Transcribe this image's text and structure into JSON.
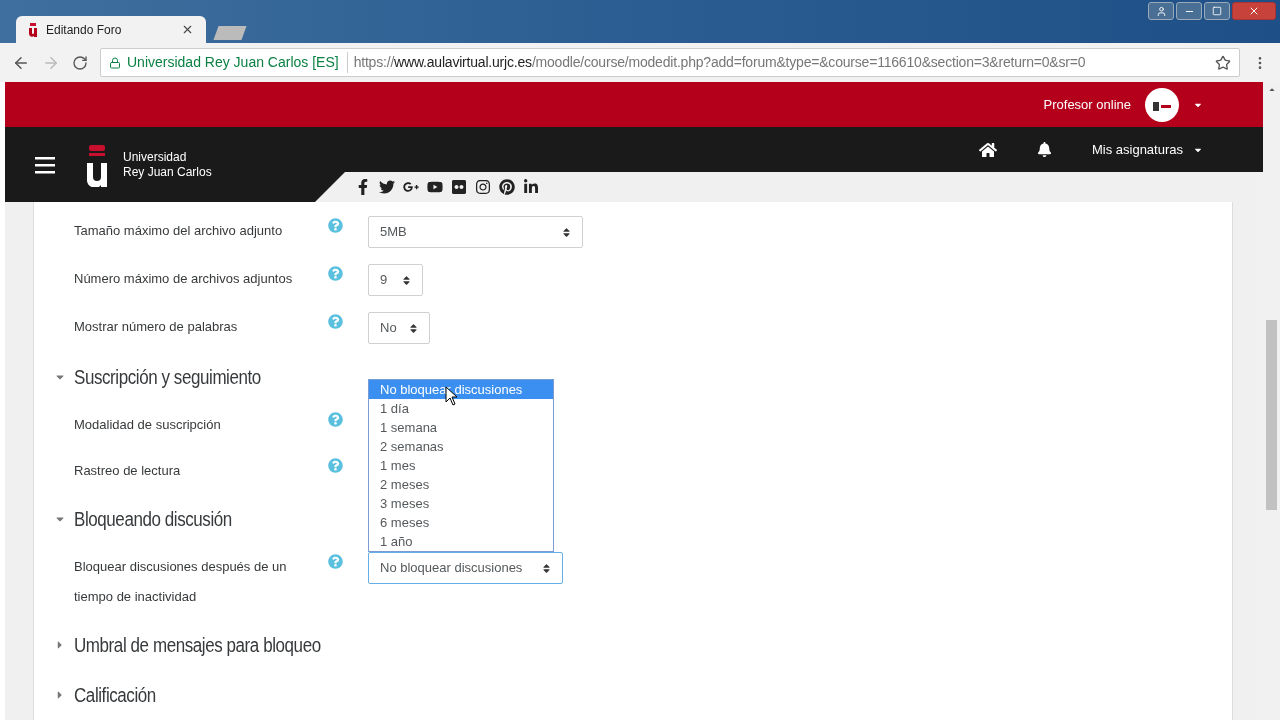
{
  "browser": {
    "tab_title": "Editando Foro",
    "site_name": "Universidad Rey Juan Carlos [ES]",
    "url_scheme": "https://",
    "url_host": "www.aulavirtual.urjc.es",
    "url_path": "/moodle/course/modedit.php?add=forum&type=&course=116610&section=3&return=0&sr=0"
  },
  "header": {
    "user_name": "Profesor online",
    "logo_lines": [
      "Universidad",
      "Rey Juan Carlos"
    ],
    "nav_link": "Mis asignaturas"
  },
  "form": [
    {
      "kind": "field",
      "label": "Tamaño máximo del archivo adjunto",
      "value": "5MB"
    },
    {
      "kind": "field",
      "label": "Número máximo de archivos adjuntos",
      "value": "9"
    },
    {
      "kind": "field",
      "label": "Mostrar número de palabras",
      "value": "No"
    },
    {
      "kind": "section",
      "title": "Suscripción y seguimiento",
      "expanded": true
    },
    {
      "kind": "field",
      "label": "Modalidad de suscripción"
    },
    {
      "kind": "field",
      "label": "Rastreo de lectura"
    },
    {
      "kind": "section",
      "title": "Bloqueando discusión",
      "expanded": true
    },
    {
      "kind": "field",
      "label": "Bloquear discusiones después de un tiempo de inactividad",
      "value": "No bloquear discusiones",
      "open": true,
      "options": [
        {
          "label": "No bloquear discusiones",
          "selected": true
        },
        {
          "label": "1 día",
          "selected": false
        },
        {
          "label": "1 semana",
          "selected": false
        },
        {
          "label": "2 semanas",
          "selected": false
        },
        {
          "label": "1 mes",
          "selected": false
        },
        {
          "label": "2 meses",
          "selected": false
        },
        {
          "label": "3 meses",
          "selected": false
        },
        {
          "label": "6 meses",
          "selected": false
        },
        {
          "label": "1 año",
          "selected": false
        }
      ]
    },
    {
      "kind": "section",
      "title": "Umbral de mensajes para bloqueo",
      "expanded": false
    },
    {
      "kind": "section",
      "title": "Calificación",
      "expanded": false
    }
  ]
}
